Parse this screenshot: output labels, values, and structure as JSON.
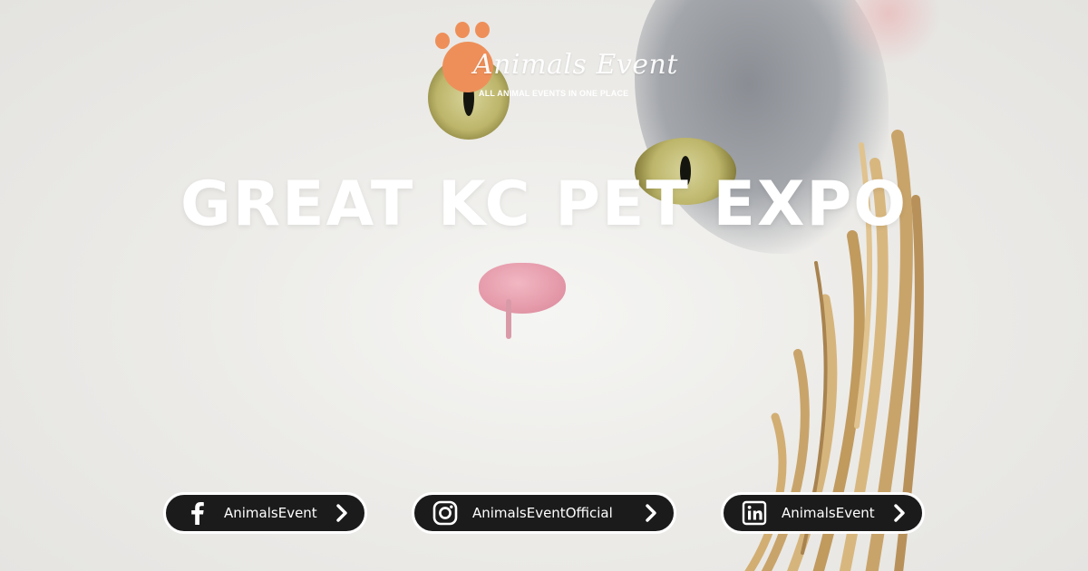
{
  "logo": {
    "title": "Animals Event",
    "tagline": "ALL ANIMAL EVENTS IN ONE PLACE"
  },
  "headline": "GREAT KC PET EXPO",
  "social": [
    {
      "platform": "facebook",
      "icon": "facebook-icon",
      "label": "AnimalsEvent"
    },
    {
      "platform": "instagram",
      "icon": "instagram-icon",
      "label": "AnimalsEventOfficial"
    },
    {
      "platform": "linkedin",
      "icon": "linkedin-icon",
      "label": "AnimalsEvent"
    }
  ],
  "colors": {
    "brand_orange": "#ee8f59",
    "pill_background": "#1b1b1b",
    "text_white": "#ffffff"
  }
}
